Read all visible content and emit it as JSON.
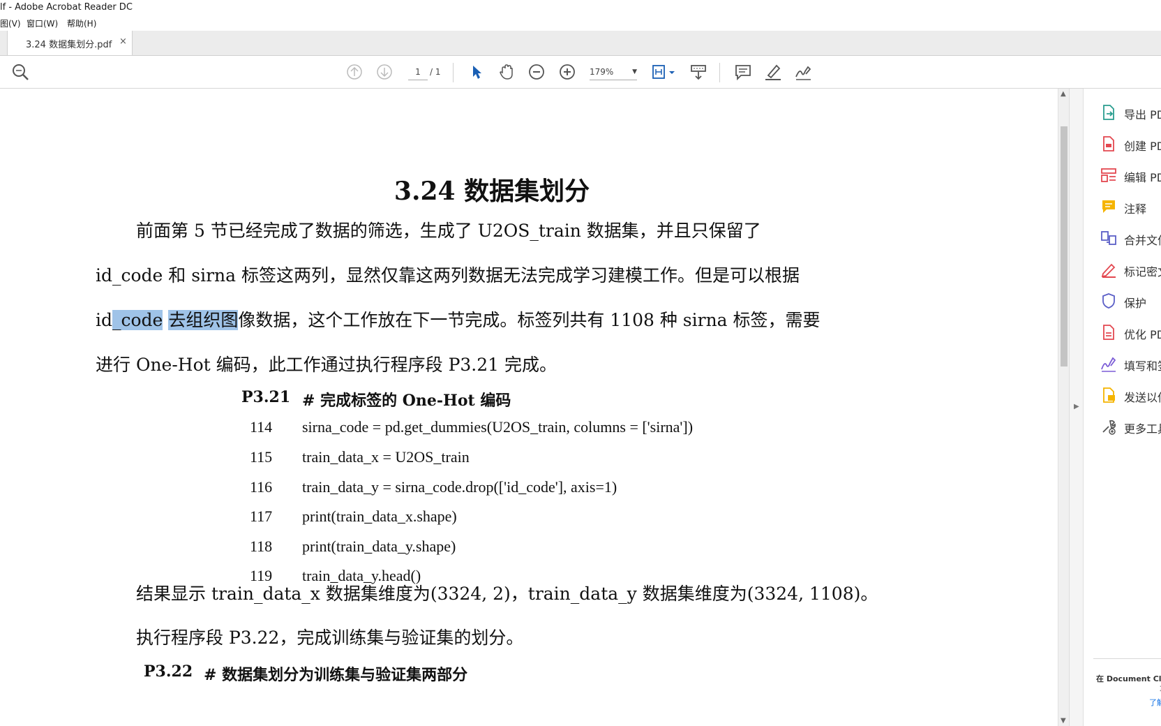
{
  "window": {
    "title": "lf - Adobe Acrobat Reader DC"
  },
  "menu": {
    "items": [
      "图(V)",
      "窗口(W)",
      "帮助(H)"
    ]
  },
  "tab": {
    "label": "3.24 数据集划分.pdf",
    "close": "×"
  },
  "toolbar": {
    "page_current": "1",
    "page_total": "/ 1",
    "zoom": "179%",
    "icons": [
      "search-zoom-icon",
      "page-up-icon",
      "page-down-icon",
      "select-arrow-icon",
      "hand-icon",
      "zoom-out-icon",
      "zoom-in-icon",
      "fit-page-icon",
      "scroll-mode-icon",
      "comment-icon",
      "highlight-pen-icon",
      "sign-icon"
    ]
  },
  "document": {
    "heading": "3.24  数据集划分",
    "p1_line1": "前面第 5 节已经完成了数据的筛选，生成了 U2OS_train 数据集，并且只保留了",
    "p1_line2": "id_code 和 sirna 标签这两列，显然仅靠这两列数据无法完成学习建模工作。但是可以根据",
    "p1_line3_a": "id",
    "p1_line3_hl1": "_code",
    "p1_line3_sp": " ",
    "p1_line3_hl2": "去组织图",
    "p1_line3_b": "像数据，这个工作放在下一节完成。标签列共有 1108 种 sirna 标签，需要",
    "p1_line4": "进行 One-Hot 编码，此工作通过执行程序段 P3.21 完成。",
    "code1_label": "P3.21",
    "code1_title": "#  完成标签的 One-Hot 编码",
    "code1": [
      {
        "n": "114",
        "t": "sirna_code = pd.get_dummies(U2OS_train, columns = ['sirna'])"
      },
      {
        "n": "115",
        "t": "train_data_x = U2OS_train"
      },
      {
        "n": "116",
        "t": "train_data_y = sirna_code.drop(['id_code'], axis=1)"
      },
      {
        "n": "117",
        "t": "print(train_data_x.shape)"
      },
      {
        "n": "118",
        "t": "print(train_data_y.shape)"
      },
      {
        "n": "119",
        "t": "train_data_y.head()"
      }
    ],
    "p2": "结果显示 train_data_x 数据集维度为(3324, 2)，train_data_y 数据集维度为(3324, 1108)。",
    "p3": "执行程序段 P3.22，完成训练集与验证集的划分。",
    "code2_label": "P3.22",
    "code2_title": "#  数据集划分为训练集与验证集两部分"
  },
  "rightpane": {
    "tools": [
      {
        "label": "导出 PDF",
        "color": "#2a9d8f"
      },
      {
        "label": "创建 PDF",
        "color": "#e34850"
      },
      {
        "label": "编辑 PDF",
        "color": "#e34850"
      },
      {
        "label": "注释",
        "color": "#f5b400"
      },
      {
        "label": "合并文件",
        "color": "#5b5fc7"
      },
      {
        "label": "标记密文",
        "color": "#e34850"
      },
      {
        "label": "保护",
        "color": "#5b5fc7"
      },
      {
        "label": "优化 PDF",
        "color": "#e34850"
      },
      {
        "label": "填写和签名",
        "color": "#7b5cd6"
      },
      {
        "label": "发送以供评论",
        "color": "#f5b400"
      },
      {
        "label": "更多工具",
        "color": "#555555"
      }
    ],
    "footer_a": "在 Document Cloud 中",
    "footer_b": "享",
    "footer_link": "了解更多"
  }
}
